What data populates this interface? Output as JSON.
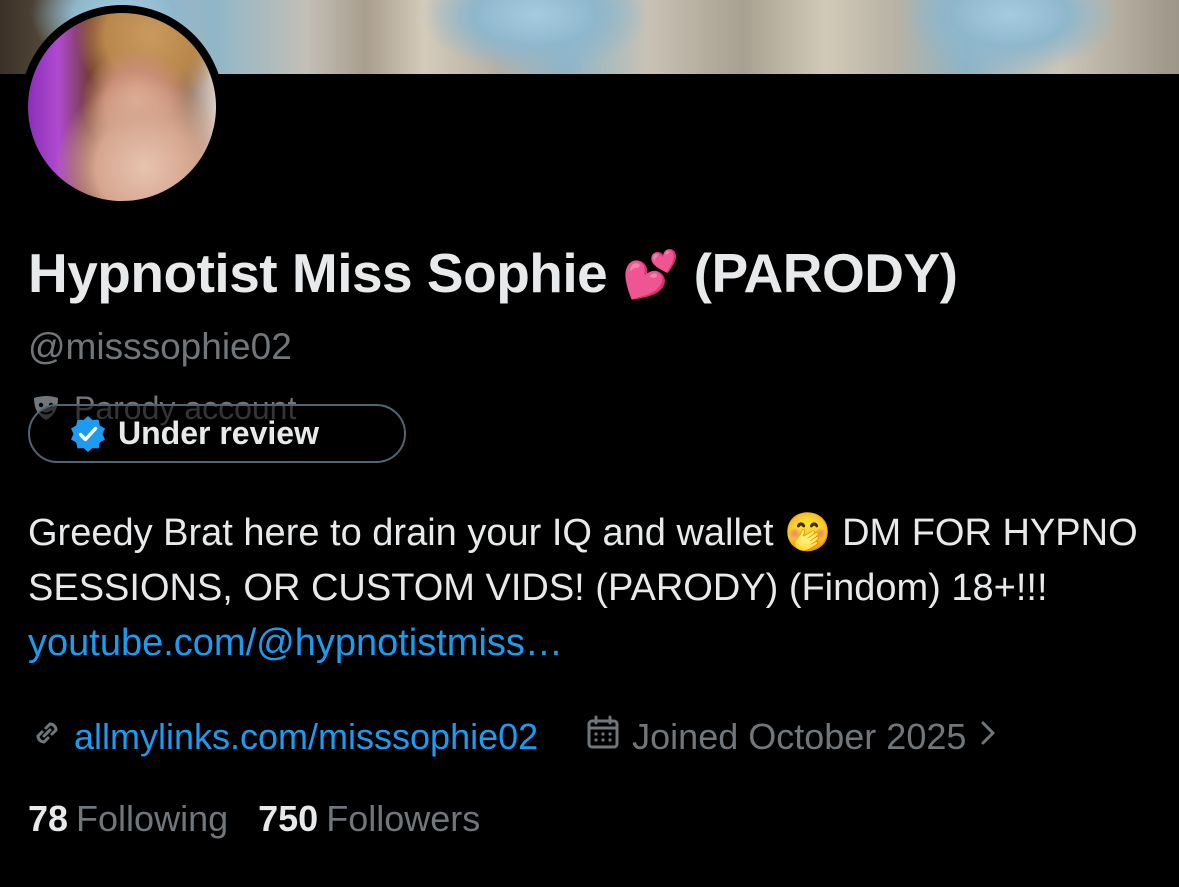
{
  "profile": {
    "display_name": "Hypnotist Miss Sophie",
    "name_emoji": "💕",
    "name_suffix": "(PARODY)",
    "handle": "@misssophie02",
    "parody_label": "Parody account",
    "verification_status": "Under review",
    "bio": {
      "text_part1": "Greedy Brat here to drain your IQ and wallet",
      "emoji": "🤭",
      "text_part2": "DM FOR HYPNO SESSIONS, OR CUSTOM VIDS! (PARODY) (Findom) 18+!!!",
      "link": "youtube.com/@hypnotistmiss…"
    },
    "website": "allmylinks.com/misssophie02",
    "joined": "Joined October 2025",
    "following_count": "78",
    "following_label": "Following",
    "followers_count": "750",
    "followers_label": "Followers"
  },
  "colors": {
    "background": "#000000",
    "text_primary": "#e7e9ea",
    "text_secondary": "#71767b",
    "link": "#1d9bf0",
    "verified_badge": "#1d9bf0"
  },
  "icons": {
    "banner": "banner-image",
    "avatar": "profile-avatar",
    "parody": "theater-mask-icon",
    "verified": "verified-badge-icon",
    "website": "link-icon",
    "joined": "calendar-icon",
    "expand": "chevron-right-icon"
  }
}
